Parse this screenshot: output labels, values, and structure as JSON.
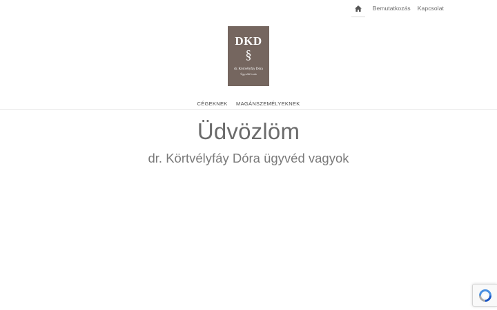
{
  "topnav": {
    "home_icon": "home-icon",
    "items": [
      {
        "label": "Bemutatkozás"
      },
      {
        "label": "Kapcsolat"
      }
    ]
  },
  "logo": {
    "mark": "DKD",
    "symbol": "§",
    "name": "dr. Körtvélyfáy Dóra",
    "subtitle": "Ügyvédi Iroda",
    "background": "#75665f"
  },
  "mainnav": {
    "items": [
      {
        "label": "CÉGEKNEK"
      },
      {
        "label": "MAGÁNSZEMÉLYEKNEK"
      }
    ]
  },
  "hero": {
    "title": "Üdvözlöm",
    "subtitle": "dr. Körtvélyfáy Dóra ügyvéd vagyok"
  },
  "recaptcha": {
    "icon": "recaptcha-icon"
  }
}
